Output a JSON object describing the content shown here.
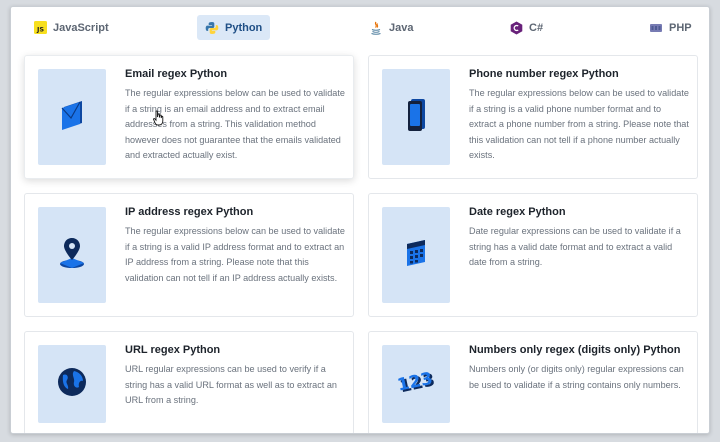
{
  "tabs": [
    {
      "label": "JavaScript",
      "icon": "javascript-logo-icon",
      "active": false
    },
    {
      "label": "Python",
      "icon": "python-logo-icon",
      "active": true
    },
    {
      "label": "Java",
      "icon": "java-logo-icon",
      "active": false
    },
    {
      "label": "C#",
      "icon": "csharp-logo-icon",
      "active": false
    },
    {
      "label": "PHP",
      "icon": "php-logo-icon",
      "active": false
    }
  ],
  "cards": [
    {
      "title": "Email regex Python",
      "description": "The regular expressions below can be used to validate if a string is an email address and to extract email addresses from a string. This validation method however does not guarantee that the emails validated and extracted actually exist.",
      "icon": "envelope-icon"
    },
    {
      "title": "Phone number regex Python",
      "description": "The regular expressions below can be used to validate if a string is a valid phone number format and to extract a phone number from a string. Please note that this validation can not tell if a phone number actually exists.",
      "icon": "smartphone-icon"
    },
    {
      "title": "IP address regex Python",
      "description": "The regular expressions below can be used to validate if a string is a valid IP address format and to extract an IP address from a string. Please note that this validation can not tell if an IP address actually exists.",
      "icon": "location-pin-icon"
    },
    {
      "title": "Date regex Python",
      "description": "Date regular expressions can be used to validate if a string has a valid date format and to extract a valid date from a string.",
      "icon": "calendar-icon"
    },
    {
      "title": "URL regex Python",
      "description": "URL regular expressions can be used to verify if a string has a valid URL format as well as to extract an URL from a string.",
      "icon": "globe-icon"
    },
    {
      "title": "Numbers only regex (digits only) Python",
      "description": "Numbers only (or digits only) regular expressions can be used to validate if a string contains only numbers.",
      "icon": "numbers-123-icon"
    }
  ],
  "colors": {
    "accent": "#1f4f86",
    "active_tab_bg": "#dbe8f7",
    "thumb_bg": "#d5e4f6",
    "icon_blue": "#1a73e8"
  }
}
